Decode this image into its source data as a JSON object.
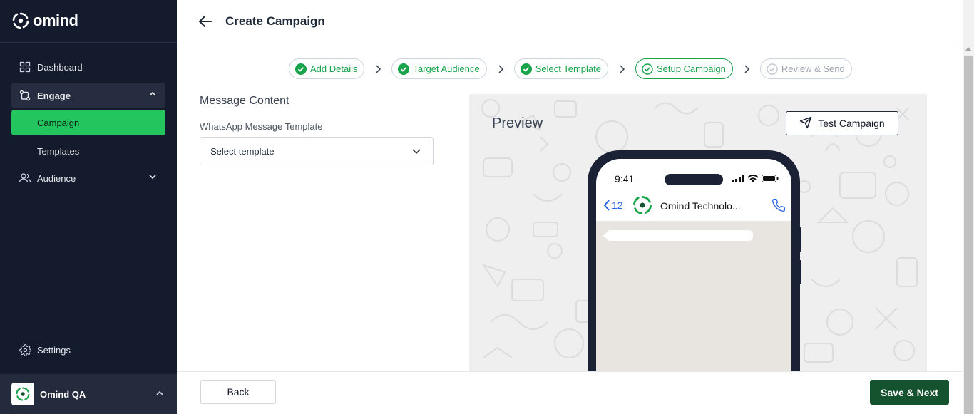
{
  "app": {
    "brand": "omind",
    "org_name": "Omind QA"
  },
  "sidebar": {
    "items": [
      {
        "label": "Dashboard",
        "icon": "grid-icon"
      },
      {
        "label": "Engage",
        "icon": "route-icon",
        "expanded": true
      },
      {
        "label": "Campaign",
        "active": true
      },
      {
        "label": "Templates"
      },
      {
        "label": "Audience",
        "icon": "users-icon",
        "expanded": false
      }
    ],
    "settings_label": "Settings"
  },
  "header": {
    "title": "Create Campaign"
  },
  "stepper": {
    "steps": [
      {
        "label": "Add Details",
        "status": "done"
      },
      {
        "label": "Target Audience",
        "status": "done"
      },
      {
        "label": "Select Template",
        "status": "done"
      },
      {
        "label": "Setup Campaign",
        "status": "current"
      },
      {
        "label": "Review & Send",
        "status": "pending"
      }
    ]
  },
  "form": {
    "section_title": "Message Content",
    "template_label": "WhatsApp Message Template",
    "template_value": "Select template"
  },
  "preview": {
    "title": "Preview",
    "test_button": "Test Campaign",
    "phone": {
      "time": "9:41",
      "back_count": "12",
      "contact_name": "Omind Technolo..."
    }
  },
  "footer": {
    "back_label": "Back",
    "next_label": "Save & Next"
  },
  "colors": {
    "sidebar_bg": "#141b2d",
    "accent_green": "#22c55e",
    "primary_dark_green": "#14532d",
    "step_green": "#16a34a"
  }
}
